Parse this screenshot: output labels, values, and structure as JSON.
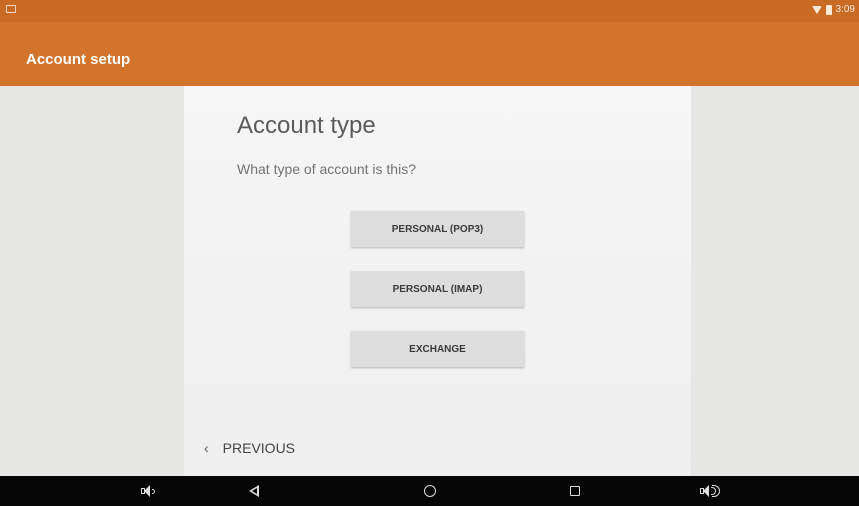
{
  "status_bar": {
    "time": "3:09",
    "icons": [
      "screenshot-icon",
      "wifi-icon",
      "battery-icon"
    ]
  },
  "app_bar": {
    "title": "Account setup"
  },
  "card": {
    "heading": "Account type",
    "subheading": "What type of account is this?",
    "buttons": {
      "pop3": "PERSONAL (POP3)",
      "imap": "PERSONAL (IMAP)",
      "exchange": "EXCHANGE"
    },
    "previous": {
      "icon": "chevron-left-icon",
      "label": "PREVIOUS"
    }
  },
  "nav_bar": {
    "items": [
      "volume-down-icon",
      "back-icon",
      "home-icon",
      "recents-icon",
      "volume-up-icon"
    ]
  },
  "colors": {
    "status_bar": "#c96a25",
    "app_bar": "#d2742b",
    "card": "#f4f4f4",
    "background": "#e7e7e5",
    "button": "#dddddd",
    "nav_bar": "#050505"
  }
}
